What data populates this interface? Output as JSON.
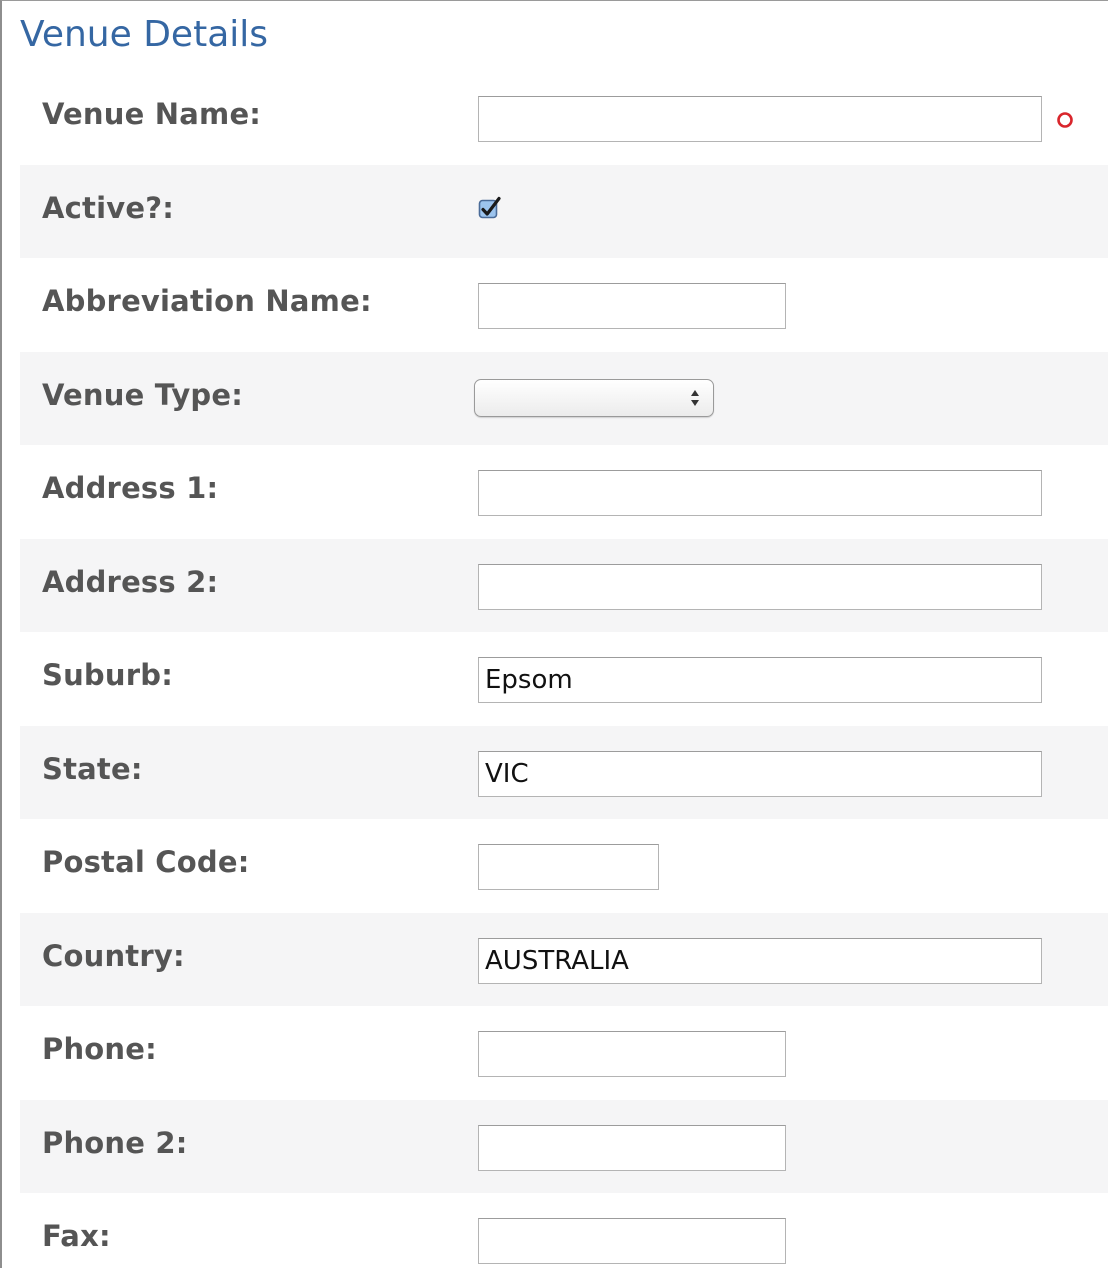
{
  "section": {
    "title": "Venue Details"
  },
  "fields": {
    "venue_name": {
      "label": "Venue Name:",
      "value": ""
    },
    "active": {
      "label": "Active?:",
      "checked": true
    },
    "abbreviation_name": {
      "label": "Abbreviation Name:",
      "value": ""
    },
    "venue_type": {
      "label": "Venue Type:",
      "selected": ""
    },
    "address_1": {
      "label": "Address 1:",
      "value": ""
    },
    "address_2": {
      "label": "Address 2:",
      "value": ""
    },
    "suburb": {
      "label": "Suburb:",
      "value": "Epsom"
    },
    "state": {
      "label": "State:",
      "value": "VIC"
    },
    "postal_code": {
      "label": "Postal Code:",
      "value": ""
    },
    "country": {
      "label": "Country:",
      "value": "AUSTRALIA"
    },
    "phone": {
      "label": "Phone:",
      "value": ""
    },
    "phone_2": {
      "label": "Phone 2:",
      "value": ""
    },
    "fax": {
      "label": "Fax:",
      "value": ""
    }
  },
  "icons": {
    "required": "required-indicator-icon",
    "checkbox": "checkmark-icon",
    "select": "updown-arrows-icon"
  },
  "colors": {
    "title": "#3567a3",
    "label": "#555555",
    "row_alt_background": "#f5f5f6",
    "required_indicator": "#d9262c",
    "checkbox_fill": "#9cc4ee",
    "checkbox_border": "#4a6b98",
    "checkmark": "#1a1a1a"
  }
}
